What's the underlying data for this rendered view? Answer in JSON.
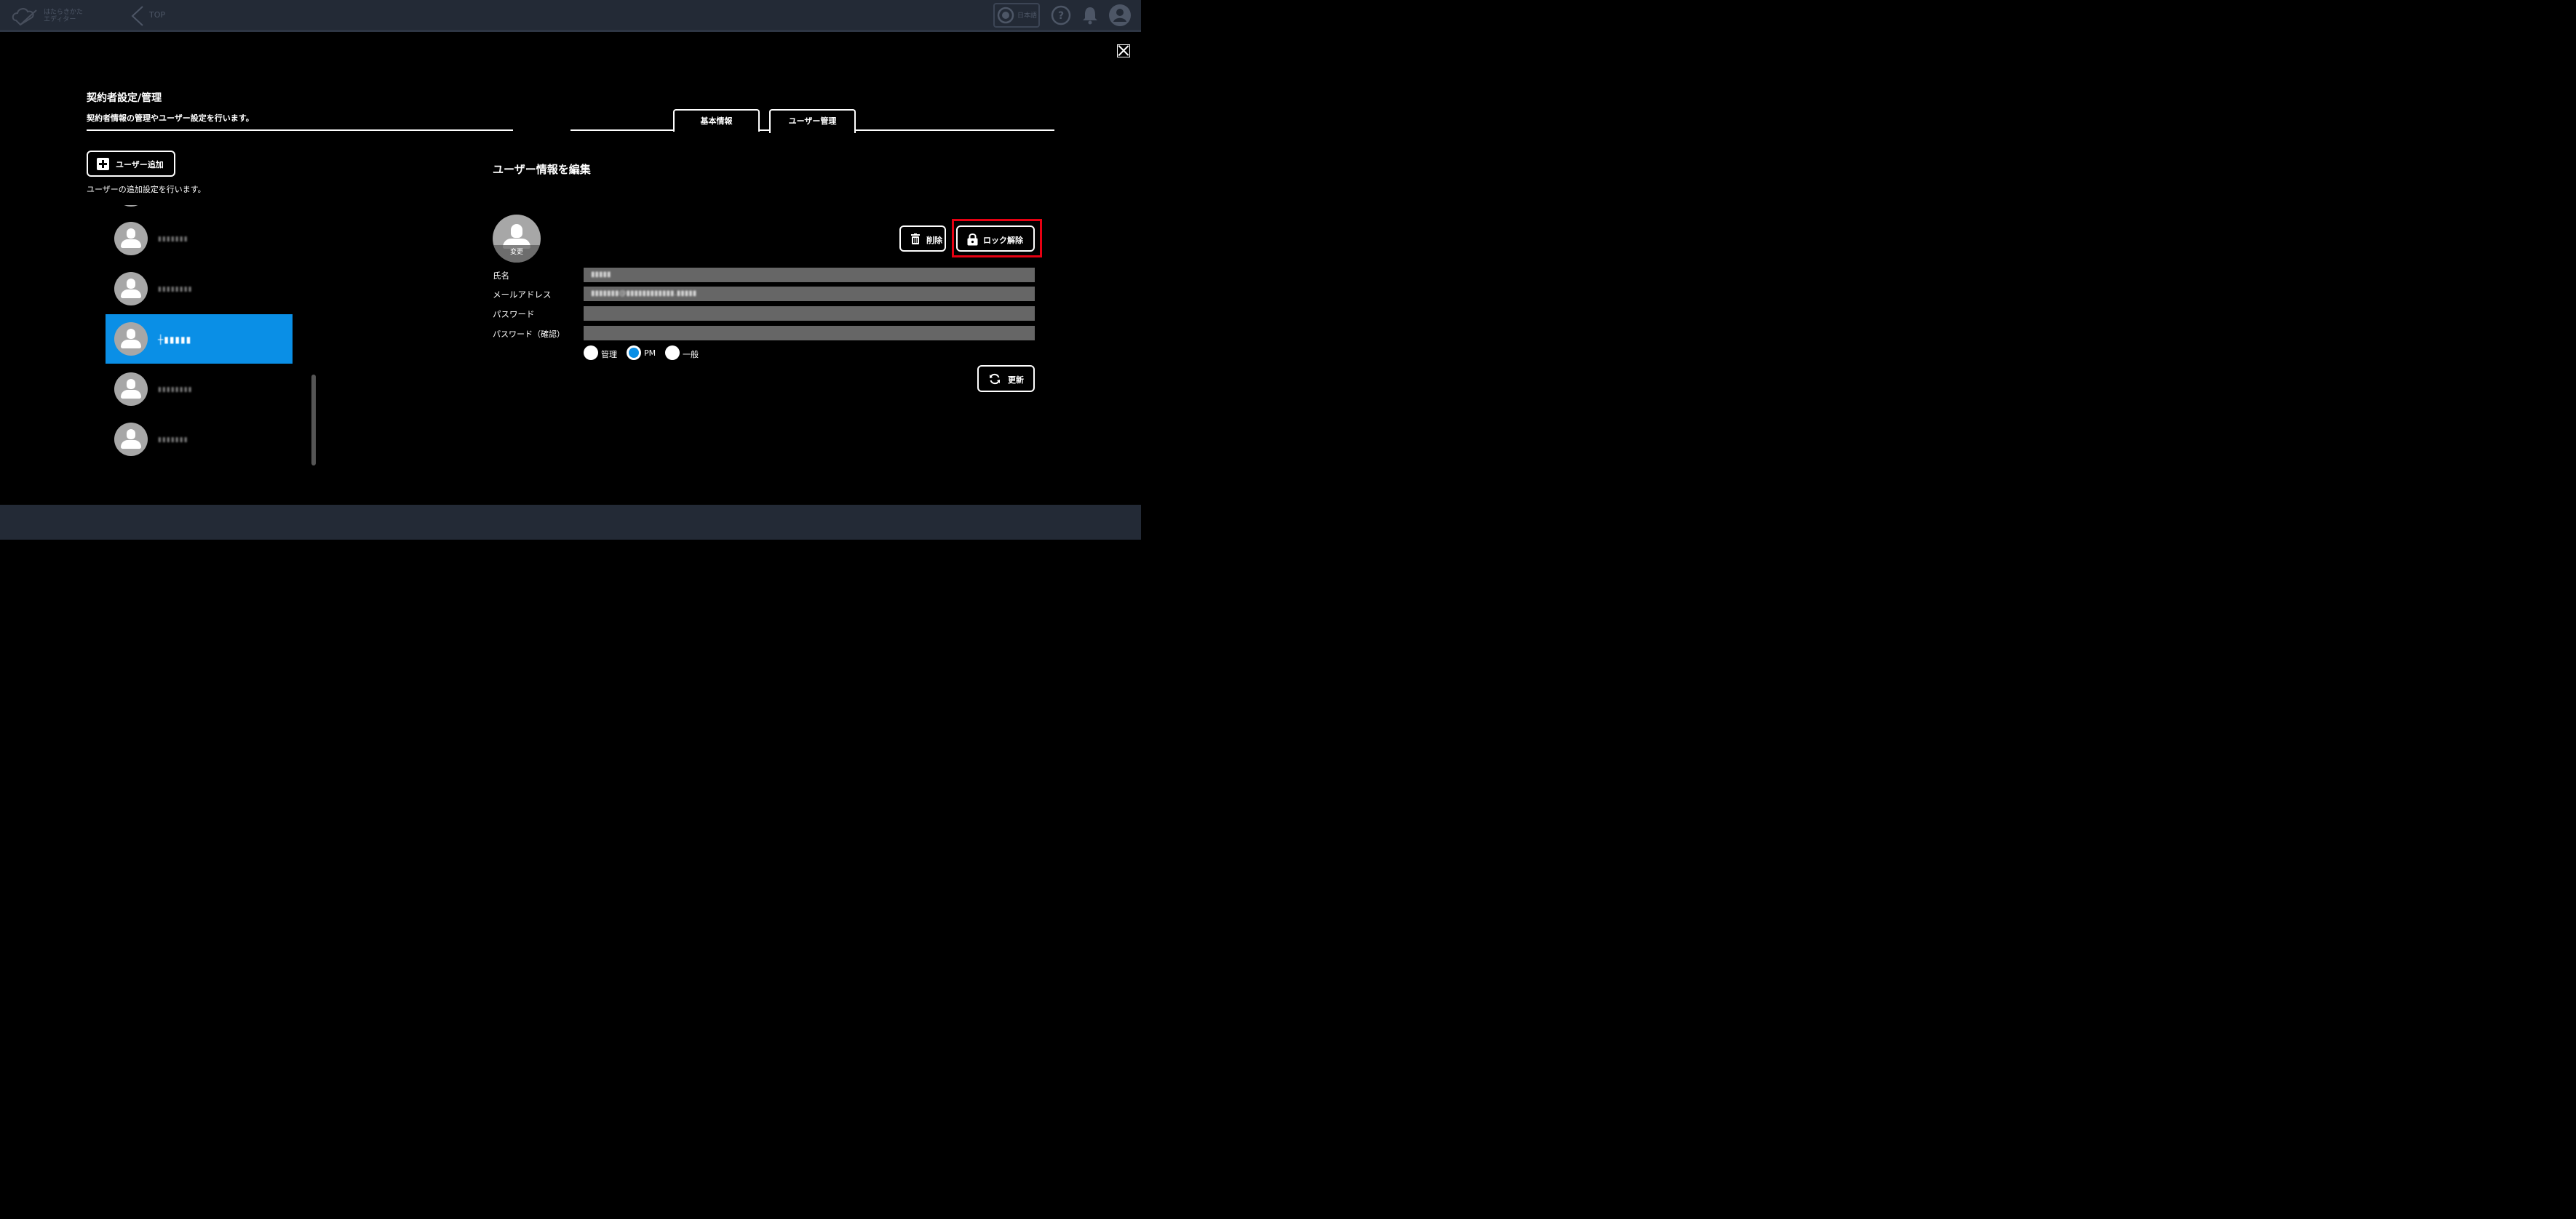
{
  "topbar": {
    "logo_text": "はたらきかた\nエディター",
    "back_label": "TOP",
    "lang_label": "日本語"
  },
  "modal": {
    "title": "契約者設定/管理",
    "subtitle": "契約者情報の管理やユーザー設定を行います。",
    "tabs": [
      {
        "label": "基本情報",
        "active": false
      },
      {
        "label": "ユーザー管理",
        "active": true
      }
    ]
  },
  "user_list": {
    "add_button": "ユーザー追加",
    "add_description": "ユーザーの追加設定を行います。",
    "users": [
      {
        "name": "▮▮▮▮▮▮▮",
        "selected": false
      },
      {
        "name": "▮▮▮▮▮▮▮▮",
        "selected": false
      },
      {
        "name": "┼▮▮▮▮▮",
        "selected": true
      },
      {
        "name": "▮▮▮▮▮▮▮▮",
        "selected": false
      },
      {
        "name": "▮▮▮▮▮▮▮",
        "selected": false
      }
    ]
  },
  "editor": {
    "title": "ユーザー情報を編集",
    "avatar_change": "変更",
    "delete_button": "削除",
    "unlock_button": "ロック解除",
    "fields": {
      "name_label": "氏名",
      "name_value": "▮▮▮▮▮",
      "email_label": "メールアドレス",
      "email_value": "▮▮▮▮▮▮▮@▮▮▮▮▮▮▮▮▮▮▮▮.▮▮▮▮▮",
      "password_label": "パスワード",
      "password_confirm_label": "パスワード（確認）"
    },
    "roles": [
      {
        "label": "管理",
        "checked": false
      },
      {
        "label": "PM",
        "checked": true
      },
      {
        "label": "一般",
        "checked": false
      }
    ],
    "update_button": "更新"
  },
  "colors": {
    "accent": "#0a8fe6",
    "highlight": "#e60012",
    "topbar": "#232a36"
  }
}
